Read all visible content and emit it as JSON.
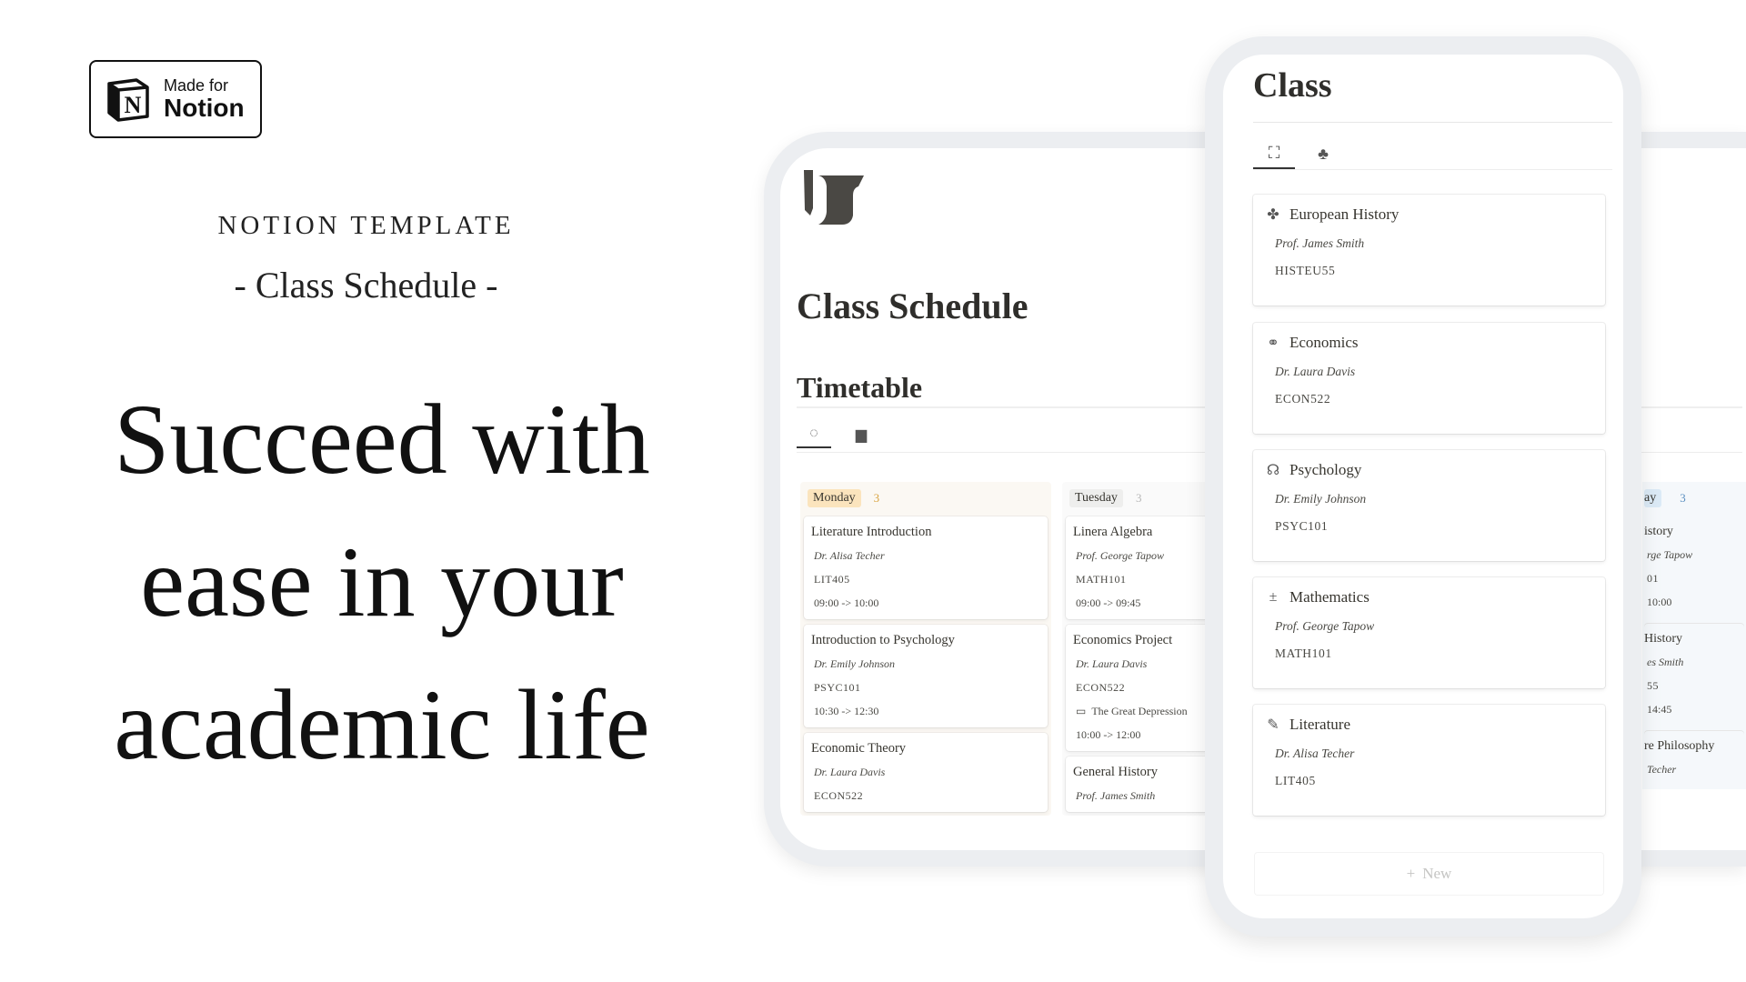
{
  "badge": {
    "line1": "Made for",
    "line2": "Notion",
    "logo_letter": "N"
  },
  "promo": {
    "kicker": "NOTION TEMPLATE",
    "subtitle": "- Class Schedule -",
    "headline": [
      "Succeed with",
      "ease in your",
      "academic life"
    ]
  },
  "tablet": {
    "title": "Class Schedule",
    "section": "Timetable",
    "tabs": [
      {
        "icon": "circle-dashed-icon",
        "glyph": "◌"
      },
      {
        "icon": "cards-icon",
        "glyph": "▆"
      }
    ],
    "columns": [
      {
        "day": "Monday",
        "count": "3",
        "tag_bg": "#fbe4bd",
        "count_color": "#d9a441",
        "bg": "#fbf8f3",
        "cards": [
          {
            "title": "Literature Introduction",
            "teacher": "Dr. Alisa Techer",
            "code": "LIT405",
            "time": "09:00 -> 10:00"
          },
          {
            "title": "Introduction to Psychology",
            "teacher": "Dr. Emily Johnson",
            "code": "PSYC101",
            "time": "10:30 -> 12:30"
          },
          {
            "title": "Economic Theory",
            "teacher": "Dr. Laura Davis",
            "code": "ECON522"
          }
        ]
      },
      {
        "day": "Tuesday",
        "count": "3",
        "tag_bg": "#eeeeed",
        "count_color": "#b7b7b7",
        "bg": "#fafafa",
        "cards": [
          {
            "title": "Linera Algebra",
            "teacher": "Prof. George Tapow",
            "code": "MATH101",
            "time": "09:00 -> 09:45"
          },
          {
            "title": "Economics Project",
            "teacher": "Dr. Laura Davis",
            "code": "ECON522",
            "topic": "The Great Depression",
            "time": "10:00 -> 12:00"
          },
          {
            "title": "General History",
            "teacher": "Prof. James Smith"
          }
        ]
      }
    ],
    "partial_column": {
      "day": "ay",
      "count": "3",
      "cards": [
        {
          "title": "istory",
          "teacher": "rge Tapow",
          "code": "01",
          "time": "10:00"
        },
        {
          "title": "History",
          "teacher": "es Smith",
          "code": "55",
          "time": "14:45"
        },
        {
          "title": "re Philosophy",
          "teacher": "Techer"
        }
      ]
    }
  },
  "phone": {
    "title": "Class",
    "tabs": [
      {
        "icon": "gallery-icon",
        "glyph": "⛶"
      },
      {
        "icon": "shapes-icon",
        "glyph": "♣"
      }
    ],
    "classes": [
      {
        "name": "European History",
        "icon": "fleur-icon",
        "glyph": "✤",
        "teacher": "Prof. James Smith",
        "code": "HISTEU55"
      },
      {
        "name": "Economics",
        "icon": "coins-icon",
        "glyph": "⚭",
        "teacher": "Dr. Laura Davis",
        "code": "ECON522"
      },
      {
        "name": "Psychology",
        "icon": "head-icon",
        "glyph": "☊",
        "teacher": "Dr. Emily Johnson",
        "code": "PSYC101"
      },
      {
        "name": "Mathematics",
        "icon": "math-operators-icon",
        "glyph": "±",
        "teacher": "Prof. George Tapow",
        "code": "MATH101"
      },
      {
        "name": "Literature",
        "icon": "brush-icon",
        "glyph": "✎",
        "teacher": "Dr. Alisa Techer",
        "code": "LIT405"
      }
    ],
    "new_label": "New"
  }
}
